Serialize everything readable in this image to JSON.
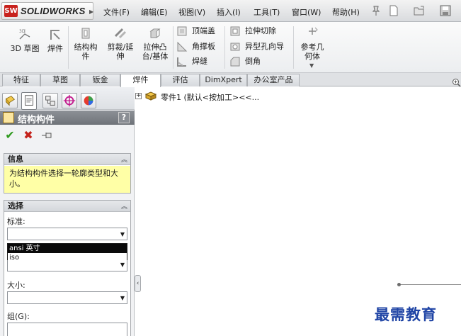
{
  "app": {
    "brand_text": "SOLIDWORKS",
    "logo_mark": "SW"
  },
  "menu": {
    "items": [
      "文件(F)",
      "编辑(E)",
      "视图(V)",
      "插入(I)",
      "工具(T)",
      "窗口(W)",
      "帮助(H)"
    ]
  },
  "toolbar_icons": [
    "pushpin-icon",
    "new-document-icon",
    "open-icon",
    "save-icon"
  ],
  "commands": {
    "sketch3d": "3D 草图",
    "weldment": "焊件",
    "structural_member": [
      "结构构",
      "件"
    ],
    "trim_extend": [
      "剪裁/延",
      "伸"
    ],
    "extruded_boss": [
      "拉伸凸",
      "台/基体"
    ],
    "end_cap": "顶端盖",
    "gusset": "角撑板",
    "weld_bead": "焊缝",
    "extruded_cut": "拉伸切除",
    "hole_wizard": "异型孔向导",
    "chamfer": "倒角",
    "ref_geometry": [
      "参考几",
      "何体"
    ]
  },
  "tabs": [
    "特征",
    "草图",
    "钣金",
    "焊件",
    "评估",
    "DimXpert",
    "办公室产品"
  ],
  "active_tab": "焊件",
  "property_manager": {
    "title": "结构构件",
    "help": "?",
    "pm_tabs": [
      "featuremanager-icon",
      "propertymanager-icon",
      "configurationmanager-icon",
      "dimxpert-manager-icon",
      "display-manager-icon"
    ],
    "actions": {
      "ok": "✔",
      "cancel": "✖",
      "pin": "pin-icon"
    },
    "info_group": {
      "header": "信息",
      "message": "为结构构件选择一轮廓类型和大小。"
    },
    "selection_group": {
      "header": "选择",
      "standard_label": "标准:",
      "standard_value": "",
      "standard_options": [
        "ansi 英寸",
        "iso"
      ],
      "highlighted_option": "ansi 英寸",
      "type_value": "",
      "size_label": "大小:",
      "size_value": "",
      "groups_label": "组(G):"
    }
  },
  "feature_tree": {
    "root_label": "零件1 (默认<按加工><<..."
  },
  "watermark": "最需教育"
}
